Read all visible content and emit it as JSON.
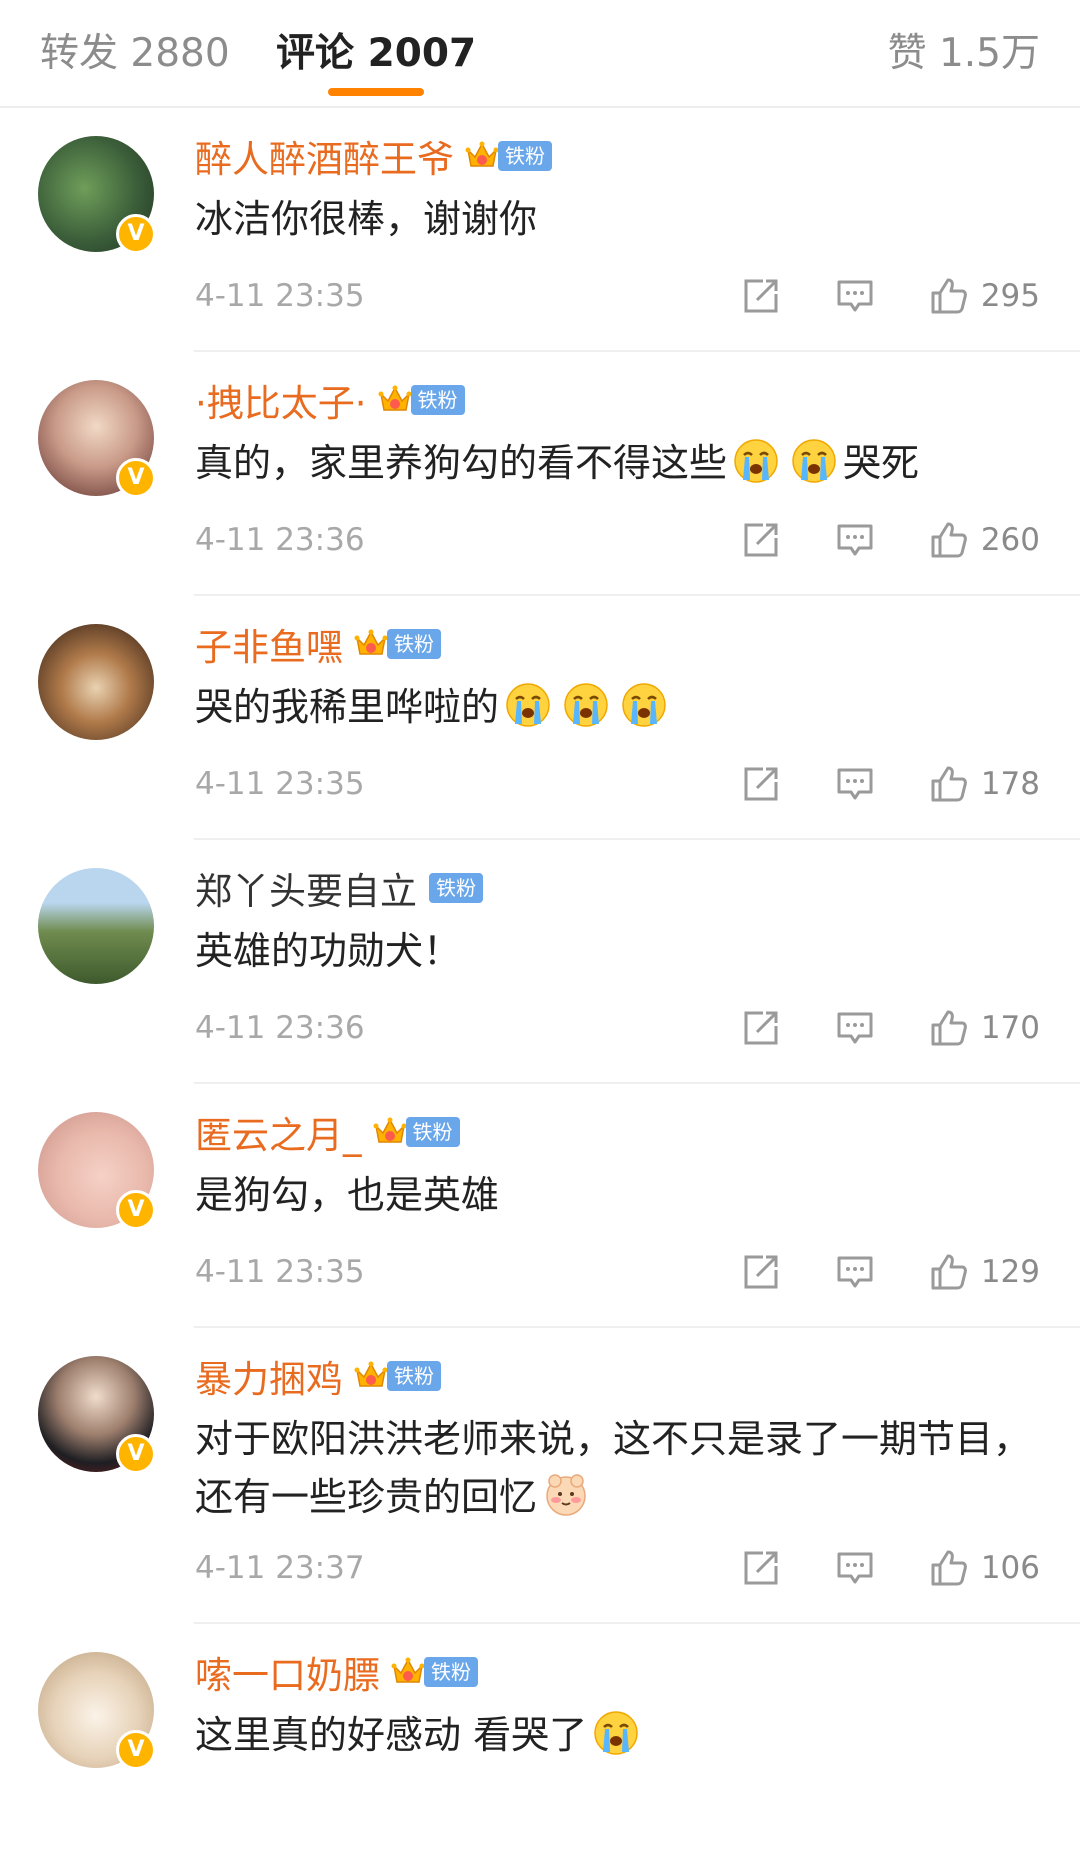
{
  "tabs": {
    "repost": "转发 2880",
    "comments": "评论 2007",
    "likes": "赞 1.5万"
  },
  "colors": {
    "accent": "#ff8200",
    "vip_name": "#e86b1f",
    "fan_badge": "#6aa7ea",
    "verified": "#ffb500"
  },
  "icons": {
    "share": "share-icon",
    "reply": "comment-icon",
    "like": "thumbs-up-icon",
    "emoji_cry": "crying-emoji",
    "emoji_blush": "shy-emoji",
    "crown": "crown-icon",
    "verified": "verified-badge"
  },
  "comments": [
    {
      "name": "醉人醉酒醉王爷",
      "badge": "铁粉",
      "text": "冰洁你很棒，谢谢你",
      "time": "4-11 23:35",
      "likes": "295"
    },
    {
      "name": "·拽比太子·",
      "badge": "铁粉",
      "text": "真的，家里养狗勾的看不得这些",
      "text_after": "哭死",
      "time": "4-11 23:36",
      "likes": "260"
    },
    {
      "name": "子非鱼嘿",
      "badge": "铁粉",
      "text": "哭的我稀里哗啦的",
      "time": "4-11 23:35",
      "likes": "178"
    },
    {
      "name": "郑丫头要自立",
      "badge": "铁粉",
      "text": "英雄的功勋犬！",
      "time": "4-11 23:36",
      "likes": "170"
    },
    {
      "name": "匿云之月_",
      "badge": "铁粉",
      "text": "是狗勾，也是英雄",
      "time": "4-11 23:35",
      "likes": "129"
    },
    {
      "name": "暴力捆鸡",
      "badge": "铁粉",
      "text": "对于欧阳洪洪老师来说，这不只是录了一期节目，还有一些珍贵的回忆",
      "time": "4-11 23:37",
      "likes": "106"
    },
    {
      "name": "嗦一口奶膘",
      "badge": "铁粉",
      "text": "这里真的好感动 看哭了"
    }
  ]
}
